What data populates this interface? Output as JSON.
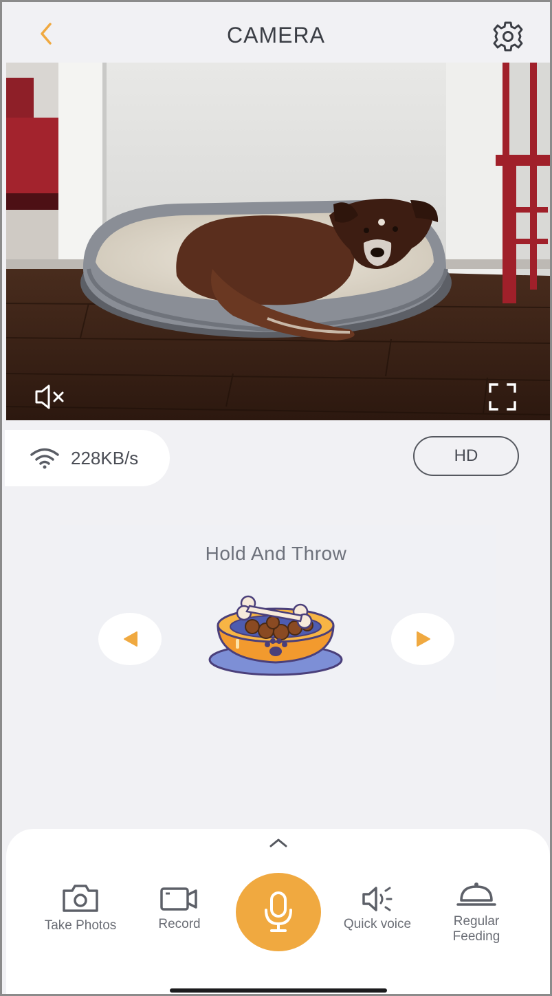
{
  "header": {
    "title": "CAMERA",
    "back_icon": "chevron-left-icon",
    "settings_icon": "gear-icon"
  },
  "video": {
    "mute_icon": "speaker-muted-icon",
    "fullscreen_icon": "fullscreen-icon"
  },
  "status": {
    "wifi_icon": "wifi-icon",
    "speed": "228KB/s",
    "quality_label": "HD"
  },
  "feeding": {
    "instruction": "Hold And Throw",
    "bowl_icon": "food-bowl-icon",
    "prev_icon": "triangle-left-icon",
    "next_icon": "triangle-right-icon"
  },
  "actions": {
    "take_photos": "Take Photos",
    "record": "Record",
    "quick_voice": "Quick voice",
    "regular_feeding_line1": "Regular",
    "regular_feeding_line2": "Feeding",
    "mic_icon": "microphone-icon",
    "expand_icon": "chevron-up-icon"
  },
  "colors": {
    "accent": "#f0a940",
    "background": "#f1f1f4",
    "text": "#4a4d55"
  }
}
